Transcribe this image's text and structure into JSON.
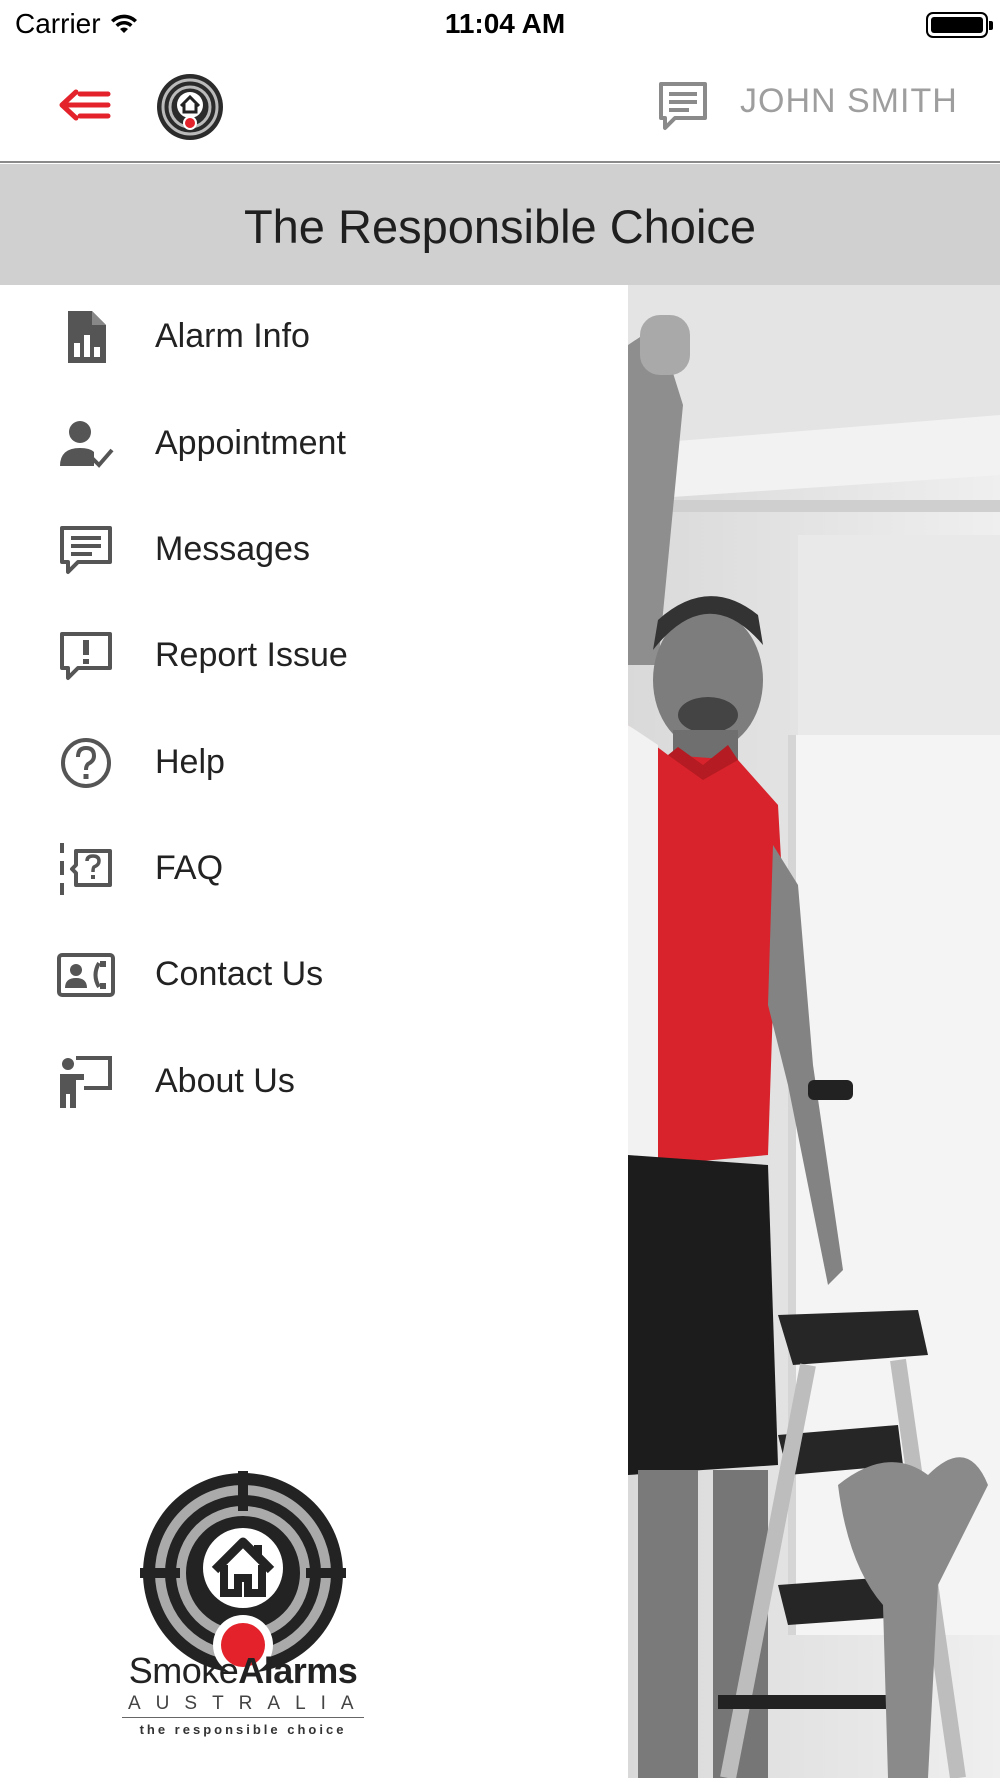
{
  "status_bar": {
    "carrier": "Carrier",
    "time": "11:04 AM"
  },
  "header": {
    "user_name": "JOHN SMITH",
    "icons": {
      "back": "back-arrow-menu-icon",
      "logo": "smoke-alarm-logo-icon",
      "messages": "message-icon"
    },
    "accent_color": "#e3222b"
  },
  "banner": {
    "title": "The Responsible Choice"
  },
  "drawer": {
    "items": [
      {
        "label": "Alarm Info",
        "icon": "report-icon"
      },
      {
        "label": "Appointment",
        "icon": "person-check-icon"
      },
      {
        "label": "Messages",
        "icon": "message-icon"
      },
      {
        "label": "Report Issue",
        "icon": "report-issue-icon"
      },
      {
        "label": "Help",
        "icon": "help-circle-icon"
      },
      {
        "label": "FAQ",
        "icon": "faq-icon"
      },
      {
        "label": "Contact Us",
        "icon": "contact-card-icon"
      },
      {
        "label": "About Us",
        "icon": "presenter-icon"
      }
    ],
    "brand": {
      "name_light": "Smoke",
      "name_bold": "Alarms",
      "country": "AUSTRALIA",
      "tagline": "the responsible choice"
    }
  }
}
